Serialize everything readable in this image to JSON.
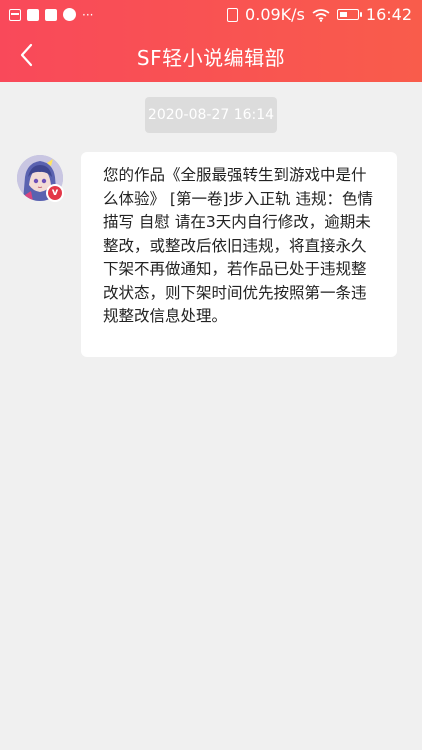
{
  "status_bar": {
    "network_speed": "0.09K/s",
    "time": "16:42",
    "left_icons": [
      "calendar-icon",
      "square-icon",
      "square-icon",
      "globe-icon"
    ],
    "more": "···",
    "right_icons": [
      "phone-icon",
      "wifi-icon",
      "battery-icon"
    ]
  },
  "header": {
    "title": "SF轻小说编辑部"
  },
  "messages": [
    {
      "timestamp": "2020-08-27 16:14",
      "text": "您的作品《全服最强转生到游戏中是什么体验》 [第一卷]步入正轨 违规：色情描写 自慰 请在3天内自行修改，逾期未整改，或整改后依旧违规，将直接永久下架不再做通知，若作品已处于违规整改状态，则下架时间优先按照第一条违规整改信息处理。",
      "badge": "v"
    }
  ],
  "colors": {
    "header_start": "#f9495a",
    "header_end": "#f95c4b",
    "background": "#f0f0f0",
    "timestamp_bg": "#dcdcdc",
    "badge": "#e33848"
  }
}
